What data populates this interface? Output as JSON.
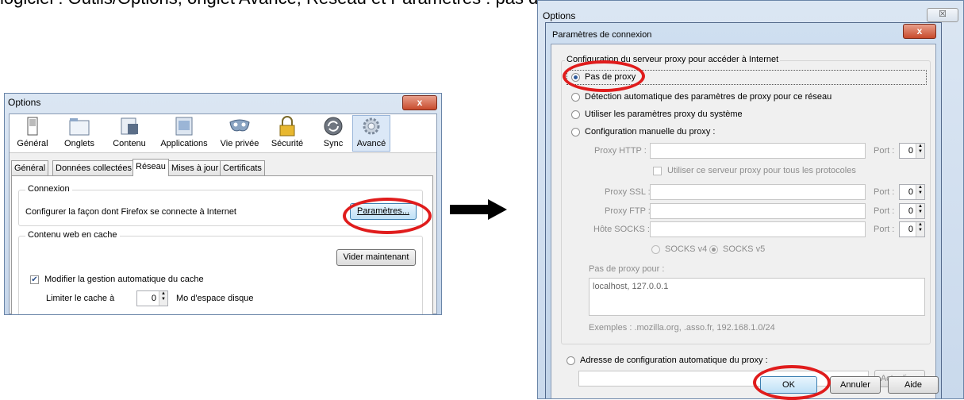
{
  "top_text": "logiciel : Outils/Options, onglet Avancé, Réseau et Paramètres : pas de proxy",
  "left_window": {
    "title": "Options",
    "close_label": "x",
    "toolbar": [
      {
        "label": "Général",
        "icon": "switch-icon"
      },
      {
        "label": "Onglets",
        "icon": "tabs-icon"
      },
      {
        "label": "Contenu",
        "icon": "content-icon"
      },
      {
        "label": "Applications",
        "icon": "applications-icon"
      },
      {
        "label": "Vie privée",
        "icon": "mask-icon"
      },
      {
        "label": "Sécurité",
        "icon": "lock-icon"
      },
      {
        "label": "Sync",
        "icon": "sync-icon"
      },
      {
        "label": "Avancé",
        "icon": "gear-icon"
      }
    ],
    "tabs": [
      "Général",
      "Données collectées",
      "Réseau",
      "Mises à jour",
      "Certificats"
    ],
    "selected_tab": "Réseau",
    "connexion_title": "Connexion",
    "connexion_text": "Configurer la façon dont Firefox se connecte à Internet",
    "parametres_button": "Paramètres...",
    "cache_title": "Contenu web en cache",
    "vider_button": "Vider maintenant",
    "modifier_checkbox": "Modifier la gestion automatique du cache",
    "limiter_label": "Limiter le cache à",
    "limiter_value": "0",
    "mo_label": "Mo d'espace disque"
  },
  "right_window": {
    "title": "Options",
    "close_label": "☒",
    "dialog_title": "Paramètres de connexion",
    "dialog_close": "x",
    "group_title": "Configuration du serveur proxy pour accéder à Internet",
    "options": [
      "Pas de proxy",
      "Détection automatique des paramètres de proxy pour ce réseau",
      "Utiliser les paramètres proxy du système",
      "Configuration manuelle du proxy :"
    ],
    "selected_option": "Pas de proxy",
    "http_label": "Proxy HTTP :",
    "port_label": "Port :",
    "port_value": "0",
    "use_same_label": "Utiliser ce serveur proxy pour tous les protocoles",
    "ssl_label": "Proxy SSL :",
    "ftp_label": "Proxy FTP :",
    "socks_label": "Hôte SOCKS :",
    "socks_v4": "SOCKS v4",
    "socks_v5": "SOCKS v5",
    "no_proxy_label": "Pas de proxy pour :",
    "no_proxy_value": "localhost, 127.0.0.1",
    "examples": "Exemples : .mozilla.org, .asso.fr, 192.168.1.0/24",
    "auto_config_label": "Adresse de configuration automatique du proxy :",
    "actualiser_button": "Actualiser",
    "ok_button": "OK",
    "annuler_button": "Annuler",
    "aide_button": "Aide"
  },
  "colors": {
    "highlight": "#e01c1c",
    "accent": "#2d5a9b"
  }
}
